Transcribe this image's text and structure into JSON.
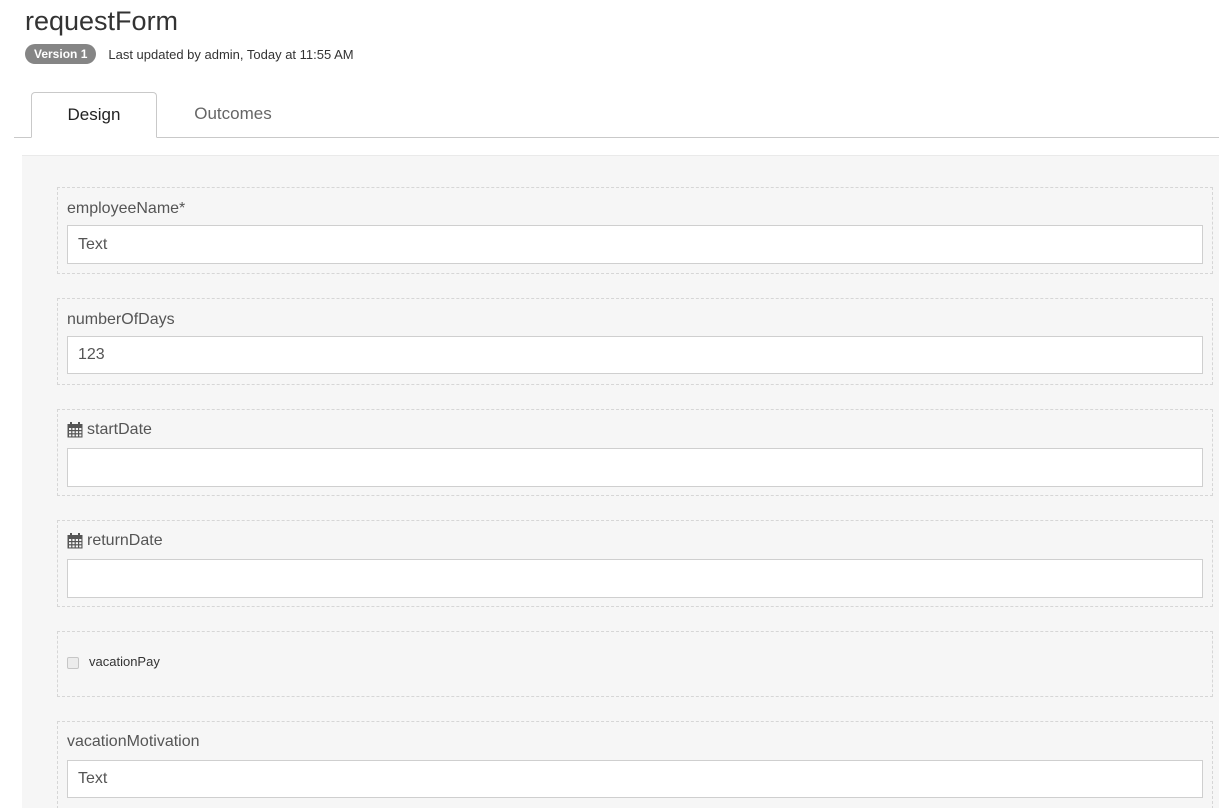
{
  "header": {
    "title": "requestForm",
    "version_badge": "Version 1",
    "updated_text": "Last updated by admin, Today at 11:55 AM"
  },
  "tabs": [
    {
      "label": "Design",
      "active": true
    },
    {
      "label": "Outcomes",
      "active": false
    }
  ],
  "fields": {
    "employee_name": {
      "label": "employeeName*",
      "placeholder": "Text"
    },
    "number_of_days": {
      "label": "numberOfDays",
      "placeholder": "123"
    },
    "start_date": {
      "label": "startDate",
      "icon": "calendar-icon",
      "value": ""
    },
    "return_date": {
      "label": "returnDate",
      "icon": "calendar-icon",
      "value": ""
    },
    "vacation_pay": {
      "label": "vacationPay",
      "checked": false
    },
    "vacation_motivation": {
      "label": "vacationMotivation",
      "placeholder": "Text"
    }
  }
}
